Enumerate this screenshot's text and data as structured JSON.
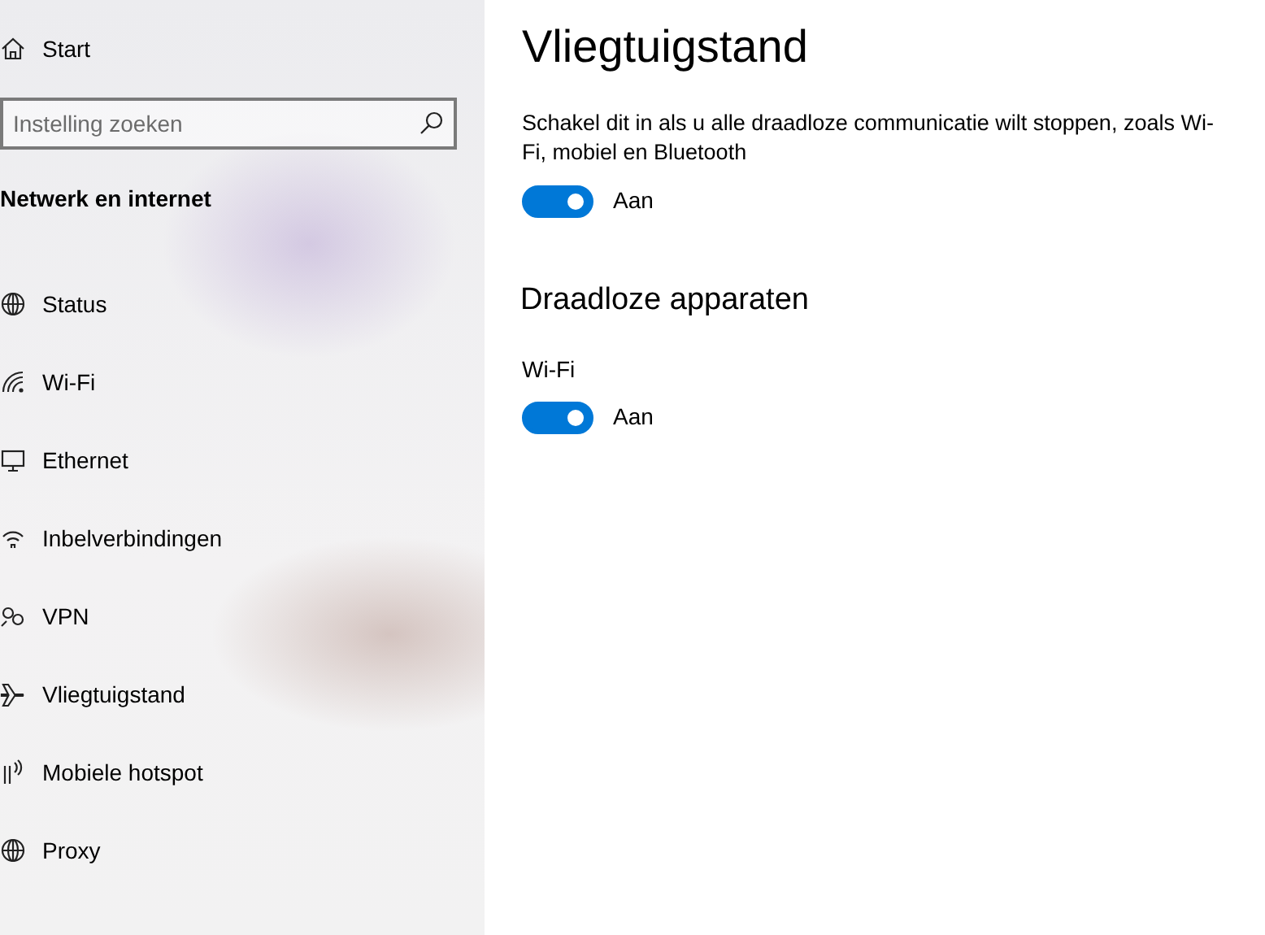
{
  "sidebar": {
    "home": "Start",
    "search": {
      "placeholder": "Instelling zoeken"
    },
    "section": "Netwerk en internet",
    "items": [
      {
        "label": "Status"
      },
      {
        "label": "Wi-Fi"
      },
      {
        "label": "Ethernet"
      },
      {
        "label": "Inbelverbindingen"
      },
      {
        "label": "VPN"
      },
      {
        "label": "Vliegtuigstand"
      },
      {
        "label": "Mobiele hotspot"
      },
      {
        "label": "Proxy"
      }
    ]
  },
  "main": {
    "title": "Vliegtuigstand",
    "description": "Schakel dit in als u alle draadloze communicatie wilt stoppen, zoals Wi-Fi, mobiel en Bluetooth",
    "airplane_toggle": {
      "on": true,
      "state_label": "Aan"
    },
    "subtitle": "Draadloze apparaten",
    "devices": [
      {
        "label": "Wi-Fi",
        "on": true,
        "state_label": "Aan"
      }
    ]
  }
}
